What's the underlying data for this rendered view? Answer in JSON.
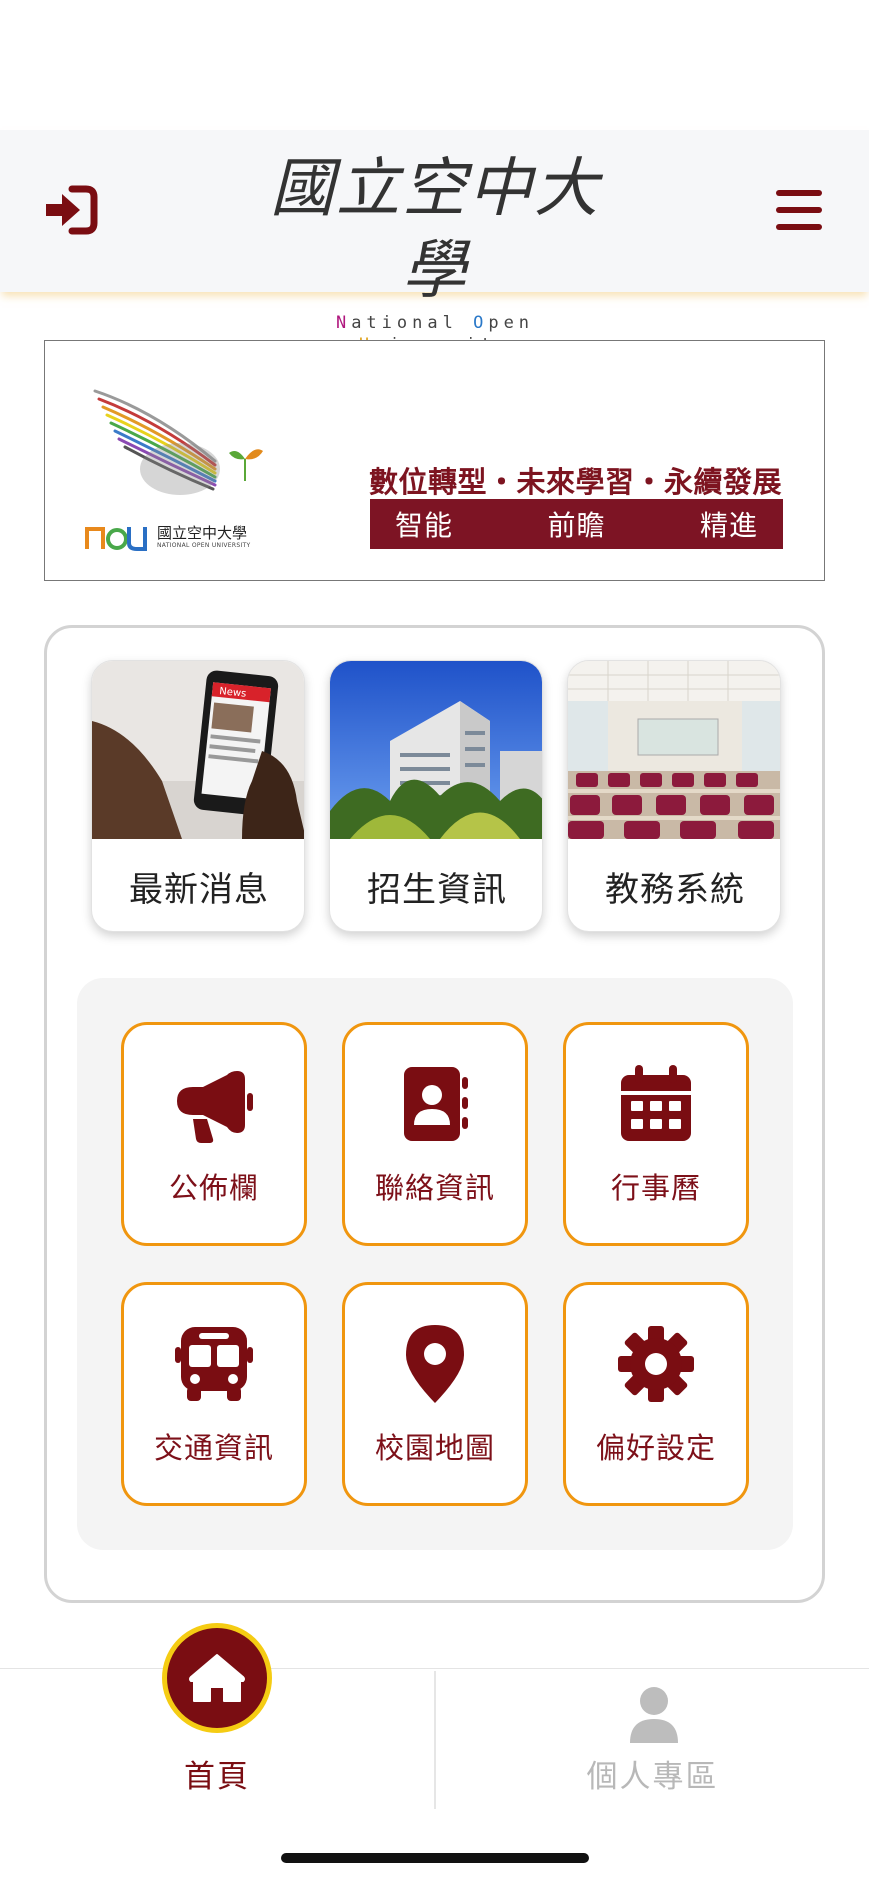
{
  "header": {
    "logo_cn": "國立空中大學",
    "logo_en_parts": [
      "N",
      "ational ",
      "O",
      "pen ",
      "U",
      "niversity"
    ],
    "login_icon": "sign-in-icon",
    "menu_icon": "hamburger-menu-icon",
    "brand_color": "#7a0d12"
  },
  "banner": {
    "mark_cn": "國立空中大學",
    "mark_en": "NATIONAL OPEN UNIVERSITY",
    "mark_logo": "noU",
    "slogan": "數位轉型・未來學習・永續發展",
    "keywords": [
      "智能",
      "前瞻",
      "精進"
    ]
  },
  "photo_tiles": [
    {
      "label": "最新消息",
      "image": "news-phone-photo",
      "badge": "News"
    },
    {
      "label": "招生資訊",
      "image": "campus-building-photo"
    },
    {
      "label": "教務系統",
      "image": "classroom-photo"
    }
  ],
  "grid": [
    {
      "label": "公佈欄",
      "icon": "megaphone-icon"
    },
    {
      "label": "聯絡資訊",
      "icon": "address-book-icon"
    },
    {
      "label": "行事曆",
      "icon": "calendar-icon"
    },
    {
      "label": "交通資訊",
      "icon": "bus-icon"
    },
    {
      "label": "校園地圖",
      "icon": "map-pin-icon"
    },
    {
      "label": "偏好設定",
      "icon": "gear-icon"
    }
  ],
  "bottom_nav": {
    "home_label": "首頁",
    "profile_label": "個人專區",
    "active": "home"
  },
  "colors": {
    "accent_orange": "#f0960f",
    "maroon": "#7a0d12",
    "home_ring": "#f5cc13"
  }
}
